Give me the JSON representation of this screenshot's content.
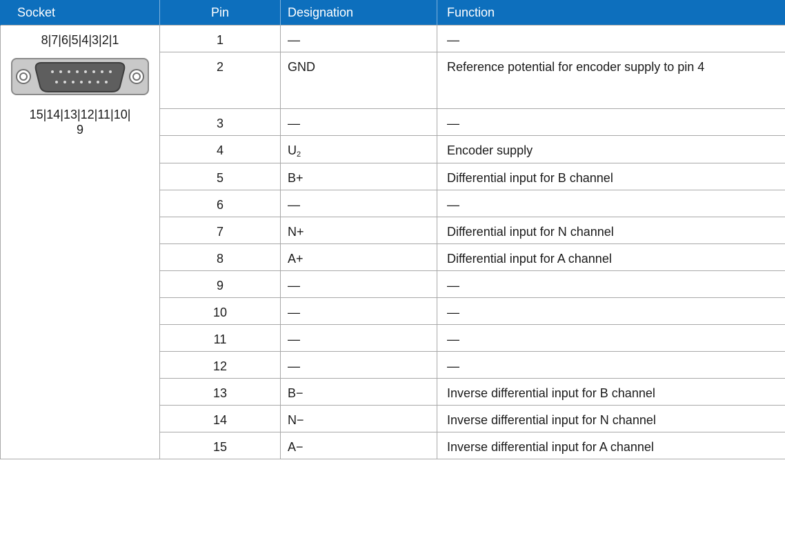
{
  "headers": {
    "socket": "Socket",
    "pin": "Pin",
    "designation": "Designation",
    "function": "Function"
  },
  "socket": {
    "pins_top": "8|7|6|5|4|3|2|1",
    "pins_bottom": "15|14|13|12|11|10|\n9",
    "icon": "d-sub-15-connector-icon"
  },
  "rows": [
    {
      "pin": "1",
      "designation": "—",
      "designation_sub": "",
      "function": "—"
    },
    {
      "pin": "2",
      "designation": "GND",
      "designation_sub": "",
      "function": "Reference potential for encoder supply to pin 4"
    },
    {
      "pin": "3",
      "designation": "—",
      "designation_sub": "",
      "function": "—"
    },
    {
      "pin": "4",
      "designation": "U",
      "designation_sub": "2",
      "function": "Encoder supply"
    },
    {
      "pin": "5",
      "designation": "B+",
      "designation_sub": "",
      "function": "Differential input for B channel"
    },
    {
      "pin": "6",
      "designation": "—",
      "designation_sub": "",
      "function": "—"
    },
    {
      "pin": "7",
      "designation": "N+",
      "designation_sub": "",
      "function": "Differential input for N channel"
    },
    {
      "pin": "8",
      "designation": "A+",
      "designation_sub": "",
      "function": "Differential input for A channel"
    },
    {
      "pin": "9",
      "designation": "—",
      "designation_sub": "",
      "function": "—"
    },
    {
      "pin": "10",
      "designation": "—",
      "designation_sub": "",
      "function": "—"
    },
    {
      "pin": "11",
      "designation": "—",
      "designation_sub": "",
      "function": "—"
    },
    {
      "pin": "12",
      "designation": "—",
      "designation_sub": "",
      "function": "—"
    },
    {
      "pin": "13",
      "designation": "B−",
      "designation_sub": "",
      "function": "Inverse differential input for B channel"
    },
    {
      "pin": "14",
      "designation": "N−",
      "designation_sub": "",
      "function": "Inverse differential input for N channel"
    },
    {
      "pin": "15",
      "designation": "A−",
      "designation_sub": "",
      "function": "Inverse differential input for A channel"
    }
  ],
  "colors": {
    "header_bg": "#0d6fbd",
    "header_text": "#ffffff",
    "border": "#a8a8a8"
  }
}
